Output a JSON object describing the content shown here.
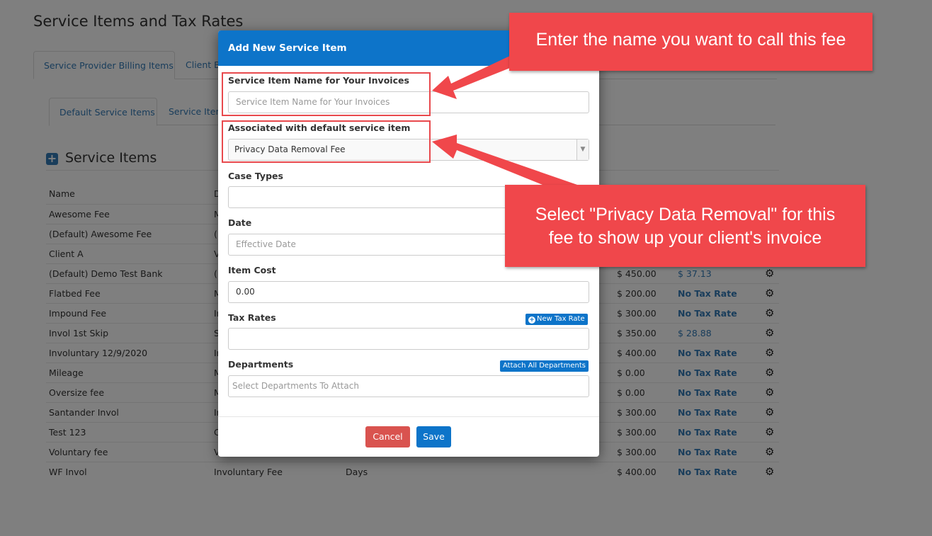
{
  "page": {
    "title": "Service Items and Tax Rates",
    "tabs": [
      "Service Provider Billing Items",
      "Client Bi"
    ],
    "subtabs": [
      "Default Service Items",
      "Service Item"
    ],
    "section_title": "Service Items"
  },
  "table": {
    "headers": {
      "name": "Name",
      "def": "D"
    },
    "rows": [
      {
        "name": "Awesome Fee",
        "def": "M",
        "unit": "",
        "cost": "",
        "tax": "",
        "tax_style": "none"
      },
      {
        "name": "(Default) Awesome Fee",
        "def": "(E",
        "unit": "",
        "cost": "",
        "tax": "",
        "tax_style": "none"
      },
      {
        "name": "Client A",
        "def": "V",
        "unit": "",
        "cost": "",
        "tax": "",
        "tax_style": "none"
      },
      {
        "name": "(Default) Demo Test Bank",
        "def": "(E",
        "unit": "",
        "cost": "$ 450.00",
        "tax": "$ 37.13",
        "tax_style": "val"
      },
      {
        "name": "Flatbed Fee",
        "def": "M",
        "unit": "",
        "cost": "$ 200.00",
        "tax": "No Tax Rate",
        "tax_style": "none"
      },
      {
        "name": "Impound Fee",
        "def": "Ir",
        "unit": "",
        "cost": "$ 300.00",
        "tax": "No Tax Rate",
        "tax_style": "none"
      },
      {
        "name": "Invol 1st Skip",
        "def": "S",
        "unit": "",
        "cost": "$ 350.00",
        "tax": "$ 28.88",
        "tax_style": "val"
      },
      {
        "name": "Involuntary 12/9/2020",
        "def": "Ir",
        "unit": "",
        "cost": "$ 400.00",
        "tax": "No Tax Rate",
        "tax_style": "none"
      },
      {
        "name": "Mileage",
        "def": "M",
        "unit": "",
        "cost": "$ 0.00",
        "tax": "No Tax Rate",
        "tax_style": "none"
      },
      {
        "name": "Oversize fee",
        "def": "M",
        "unit": "",
        "cost": "$ 0.00",
        "tax": "No Tax Rate",
        "tax_style": "none"
      },
      {
        "name": "Santander Invol",
        "def": "Ir",
        "unit": "",
        "cost": "$ 300.00",
        "tax": "No Tax Rate",
        "tax_style": "none"
      },
      {
        "name": "Test 123",
        "def": "C",
        "unit": "",
        "cost": "$ 300.00",
        "tax": "No Tax Rate",
        "tax_style": "none"
      },
      {
        "name": "Voluntary fee",
        "def": "V",
        "unit": "",
        "cost": "$ 300.00",
        "tax": "No Tax Rate",
        "tax_style": "none"
      },
      {
        "name": "WF Invol",
        "def": "Involuntary Fee",
        "unit": "Days",
        "cost": "$ 400.00",
        "tax": "No Tax Rate",
        "tax_style": "none"
      }
    ]
  },
  "modal": {
    "title": "Add New Service Item",
    "name_label": "Service Item Name for Your Invoices",
    "name_placeholder": "Service Item Name for Your Invoices",
    "assoc_label": "Associated with default service item",
    "assoc_value": "Privacy Data Removal Fee",
    "case_types_label": "Case Types",
    "date_label": "Date",
    "date_placeholder": "Effective Date",
    "cost_label": "Item Cost",
    "cost_value": "0.00",
    "tax_label": "Tax Rates",
    "new_tax_button": "New Tax Rate",
    "dept_label": "Departments",
    "attach_button": "Attach All Departments",
    "dept_placeholder": "Select Departments To Attach",
    "cancel": "Cancel",
    "save": "Save"
  },
  "callouts": {
    "top": "Enter the name you want to call this fee",
    "middle_line1": "Select \"Privacy Data Removal\" for this",
    "middle_line2": "fee to show up your client's invoice"
  },
  "colors": {
    "primary": "#0d74c9",
    "danger": "#d9534f",
    "callout": "#f0474b"
  }
}
